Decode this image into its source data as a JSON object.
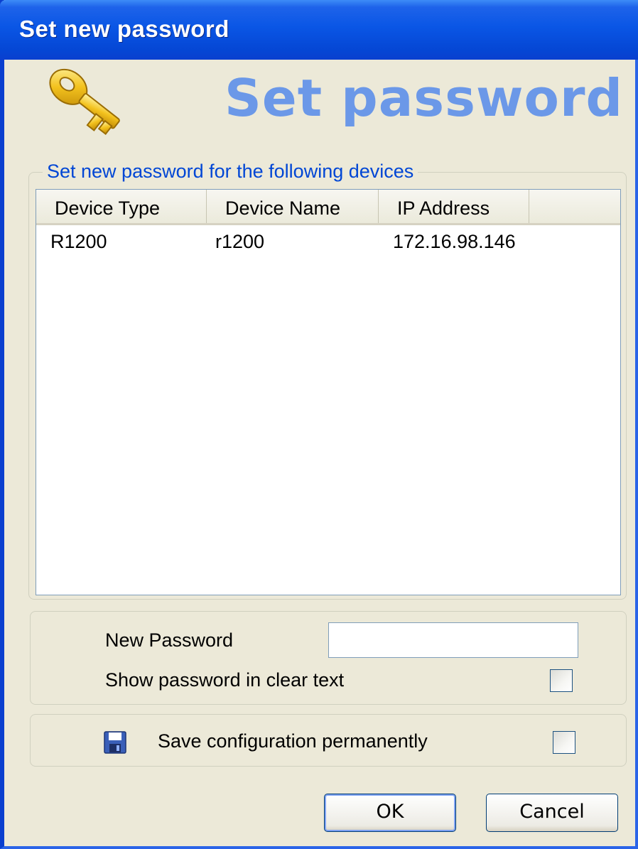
{
  "window": {
    "title": "Set new password"
  },
  "banner": {
    "text": "Set password",
    "icon": "key-icon"
  },
  "devices_group": {
    "title": "Set new password for the following devices",
    "columns": [
      "Device Type",
      "Device Name",
      "IP Address"
    ],
    "rows": [
      {
        "device_type": "R1200",
        "device_name": "r1200",
        "ip_address": "172.16.98.146"
      }
    ]
  },
  "password_group": {
    "new_password_label": "New Password",
    "new_password_value": "",
    "show_clear_label": "Show password in clear text",
    "show_clear_checked": false
  },
  "save_group": {
    "icon": "floppy-disk-icon",
    "label": "Save configuration permanently",
    "checked": false
  },
  "buttons": {
    "ok": "OK",
    "cancel": "Cancel"
  },
  "colors": {
    "titlebar": "#0a56e5",
    "banner_text": "#6b98e8",
    "group_title": "#0046d5",
    "dialog_bg": "#ece9d8"
  }
}
